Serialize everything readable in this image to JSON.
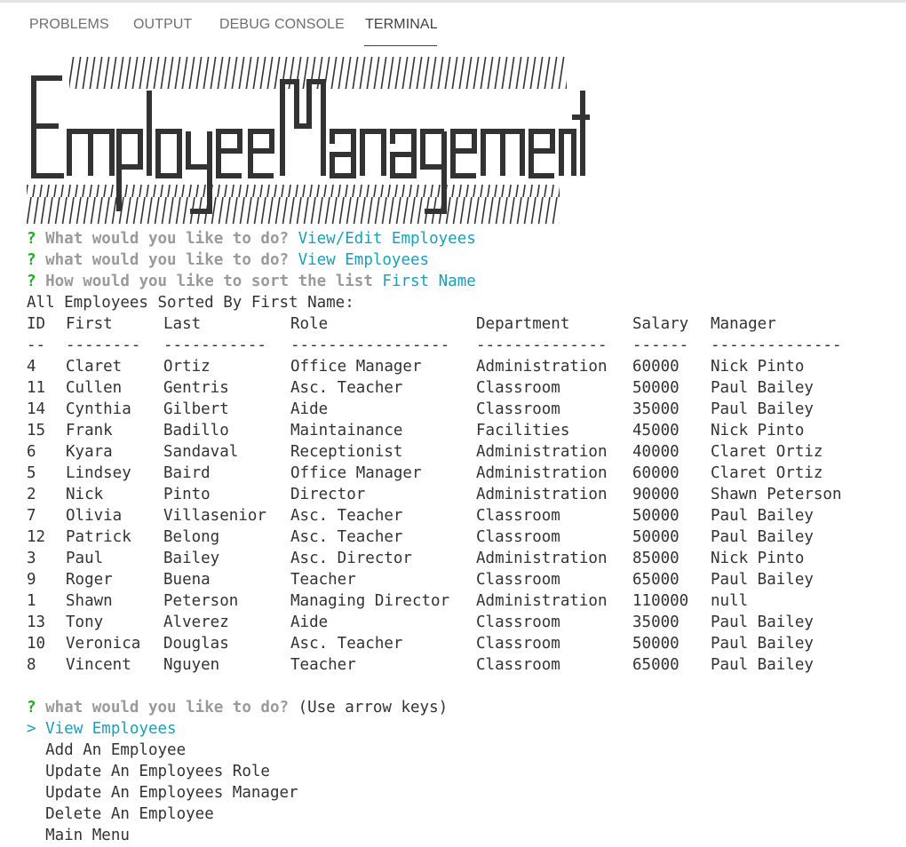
{
  "tabs": [
    {
      "label": "PROBLEMS",
      "active": false
    },
    {
      "label": "OUTPUT",
      "active": false
    },
    {
      "label": "DEBUG CONSOLE",
      "active": false
    },
    {
      "label": "TERMINAL",
      "active": true
    }
  ],
  "banner": {
    "text": "EmployeeManagement"
  },
  "prompts": [
    {
      "symbol": "?",
      "question": "What would you like to do?",
      "answer": "View/Edit Employees"
    },
    {
      "symbol": "?",
      "question": "what would you like to do?",
      "answer": "View Employees"
    },
    {
      "symbol": "?",
      "question": "How would you like to sort the list",
      "answer": "First Name"
    }
  ],
  "sort_heading": "All Employees Sorted By First Name:",
  "table": {
    "headers": [
      "ID",
      "First",
      "Last",
      "Role",
      "Department",
      "Salary",
      "Manager"
    ],
    "separators": [
      "--",
      "--------",
      "-----------",
      "-----------------",
      "--------------",
      "------",
      "--------------"
    ],
    "rows": [
      [
        "4",
        "Claret",
        "Ortiz",
        "Office Manager",
        "Administration",
        "60000",
        "Nick Pinto"
      ],
      [
        "11",
        "Cullen",
        "Gentris",
        "Asc. Teacher",
        "Classroom",
        "50000",
        "Paul Bailey"
      ],
      [
        "14",
        "Cynthia",
        "Gilbert",
        "Aide",
        "Classroom",
        "35000",
        "Paul Bailey"
      ],
      [
        "15",
        "Frank",
        "Badillo",
        "Maintainance",
        "Facilities",
        "45000",
        "Nick Pinto"
      ],
      [
        "6",
        "Kyara",
        "Sandaval",
        "Receptionist",
        "Administration",
        "40000",
        "Claret Ortiz"
      ],
      [
        "5",
        "Lindsey",
        "Baird",
        "Office Manager",
        "Administration",
        "60000",
        "Claret Ortiz"
      ],
      [
        "2",
        "Nick",
        "Pinto",
        "Director",
        "Administration",
        "90000",
        "Shawn Peterson"
      ],
      [
        "7",
        "Olivia",
        "Villasenior",
        "Asc. Teacher",
        "Classroom",
        "50000",
        "Paul Bailey"
      ],
      [
        "12",
        "Patrick",
        "Belong",
        "Asc. Teacher",
        "Classroom",
        "50000",
        "Paul Bailey"
      ],
      [
        "3",
        "Paul",
        "Bailey",
        "Asc. Director",
        "Administration",
        "85000",
        "Nick Pinto"
      ],
      [
        "9",
        "Roger",
        "Buena",
        "Teacher",
        "Classroom",
        "65000",
        "Paul Bailey"
      ],
      [
        "1",
        "Shawn",
        "Peterson",
        "Managing Director",
        "Administration",
        "110000",
        "null"
      ],
      [
        "13",
        "Tony",
        "Alverez",
        "Aide",
        "Classroom",
        "35000",
        "Paul Bailey"
      ],
      [
        "10",
        "Veronica",
        "Douglas",
        "Asc. Teacher",
        "Classroom",
        "50000",
        "Paul Bailey"
      ],
      [
        "8",
        "Vincent",
        "Nguyen",
        "Teacher",
        "Classroom",
        "65000",
        "Paul Bailey"
      ]
    ]
  },
  "menu_prompt": {
    "symbol": "?",
    "question": "what would you like to do?",
    "hint": "(Use arrow keys)"
  },
  "menu": {
    "pointer": ">",
    "items": [
      "View Employees",
      "Add An Employee",
      "Update An Employees Role",
      "Update An Employees Manager",
      "Delete An Employee",
      "Main Menu"
    ],
    "selected_index": 0
  },
  "colors": {
    "prompt_mark": "#22aa22",
    "prompt_text": "#9a9a9a",
    "answer": "#1a9fb5",
    "text": "#333333"
  }
}
